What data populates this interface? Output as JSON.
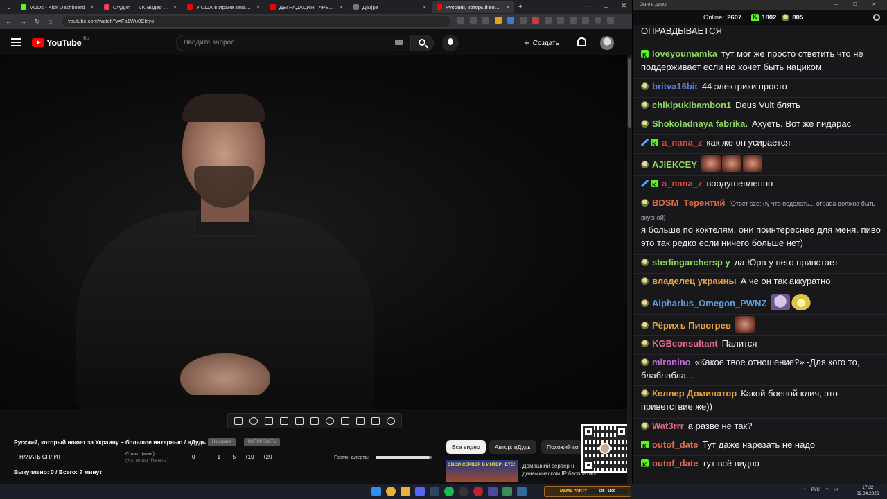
{
  "browser": {
    "tabs": [
      {
        "title": "VODs - Kick Dashboard",
        "color": "#53fc18",
        "active": false
      },
      {
        "title": "Студия — VK Видео Live",
        "color": "#ff3b5c",
        "active": false
      },
      {
        "title": "У США в Иране заканчиваются",
        "color": "#ff0000",
        "active": false
      },
      {
        "title": "ДЕГРАДАЦИЯ ТАРЕЛОЧНИЦ",
        "color": "#ff0000",
        "active": false
      },
      {
        "title": "Д[ы]ра",
        "color": "#777777",
        "active": false
      },
      {
        "title": "Русский, который воюет з",
        "color": "#ff0000",
        "active": true
      }
    ],
    "url": "youtube.com/watch?v=Fa1Wu0Cktyo"
  },
  "youtube": {
    "logo_text": "YouTube",
    "region": "RU",
    "search_placeholder": "Введите запрос",
    "create_label": "Создать"
  },
  "overlay": {
    "video_title": "Русский, который воюет за Украину – большое интервью / вДудь",
    "pill_1": "На экране",
    "pill_2": "КОПИРОВАТЬ",
    "start_split": "НАЧАТЬ СПЛИТ",
    "split_label": "Сплит (мин):",
    "split_hint": "(уст. перед \"Начать\")",
    "split_value": "0",
    "steps": [
      "+1",
      "+5",
      "+10",
      "+20"
    ],
    "alert_volume_label": "Громк. алерта:",
    "alert_volume_level": 0.95,
    "bought": "Выкуплено: 0 / Всего: ? минут",
    "chips": [
      "Все видео",
      "Автор: вДудь",
      "Похожий ко"
    ],
    "promo_banner": "СВОЙ СЕРВЕР В ИНТЕРНЕТЕ!",
    "promo_text": "Домашний сервер н динамическом IP бесплатно!..."
  },
  "chat": {
    "window_title": "Окно в дурку",
    "online_label": "Online:",
    "online_count": "2607",
    "kick_count": "1802",
    "other_count": "805",
    "messages": [
      {
        "user": "",
        "color": "#efeff1",
        "badges": [],
        "text": "ОПРАВДЫВАЕТСЯ"
      },
      {
        "user": "loveyoumamka",
        "color": "#8dd75a",
        "badges": [
          "kick"
        ],
        "text": "тут мог же просто ответить что не поддерживает если не хочет быть нациком"
      },
      {
        "user": "britva16bit",
        "color": "#5e7fd9",
        "badges": [
          "goblin"
        ],
        "text": "44 электрики просто"
      },
      {
        "user": "chikipukibambon1",
        "color": "#8dd75a",
        "badges": [
          "goblin"
        ],
        "text": "Deus Vult блять"
      },
      {
        "user": "Shokoladnaya fabrika.",
        "color": "#8dd75a",
        "badges": [
          "goblin"
        ],
        "text": "Ахуеть. Вот же пидарас"
      },
      {
        "user": "a_nana_z",
        "color": "#e0453a",
        "badges": [
          "sword",
          "kick"
        ],
        "text": "как же он усирается"
      },
      {
        "user": "AJIEKCEY",
        "color": "#8dd75a",
        "badges": [
          "goblin"
        ],
        "text": "",
        "emotes": [
          "face",
          "face",
          "face"
        ]
      },
      {
        "user": "a_nana_z",
        "color": "#e0453a",
        "badges": [
          "sword",
          "kick"
        ],
        "text": "воодушевленно"
      },
      {
        "user": "BDSM_Терентий",
        "color": "#e06a46",
        "badges": [
          "goblin"
        ],
        "reply": "[Ответ sze: ну что поделать... отрава должна быть вкусной]",
        "text": "я больше по коктелям, они поинтереснее для меня. пиво это так редко если ничего больше нет)"
      },
      {
        "user": "sterlingarchersp y",
        "color": "#8dd75a",
        "badges": [
          "goblin"
        ],
        "text": "да Юра у него привстает"
      },
      {
        "user": "владелец украины",
        "color": "#e8a33a",
        "badges": [
          "goblin"
        ],
        "text": "А че он так аккуратно"
      },
      {
        "user": "Alpharius_Omegon_PWNZ",
        "color": "#5e9fe0",
        "badges": [
          "goblin"
        ],
        "text": "",
        "emotes": [
          "anime",
          "smile"
        ]
      },
      {
        "user": "Рёрихъ Пивогрев",
        "color": "#e8a33a",
        "badges": [
          "goblin"
        ],
        "text": "",
        "emotes": [
          "face"
        ]
      },
      {
        "user": "KGBconsultant",
        "color": "#e06a8a",
        "badges": [
          "goblin"
        ],
        "text": "Палится"
      },
      {
        "user": "mironino",
        "color": "#c06ad8",
        "badges": [
          "goblin"
        ],
        "text": "«Какое твое отношение?» -Для кого то, блаблабла..."
      },
      {
        "user": "Келлер Доминатор",
        "color": "#e8a33a",
        "badges": [
          "goblin"
        ],
        "text": "Какой боевой клич, это приветствие же))"
      },
      {
        "user": "Wat3rrr",
        "color": "#e06a8a",
        "badges": [
          "goblin"
        ],
        "text": "а разве не так?"
      },
      {
        "user": "outof_date",
        "color": "#e06a46",
        "badges": [
          "kick"
        ],
        "text": "Тут даже нарезать не надо"
      },
      {
        "user": "outof_date",
        "color": "#e06a46",
        "badges": [
          "kick"
        ],
        "text": "тут всё видно"
      }
    ]
  },
  "taskbar": {
    "widget_text": "MEME PARTY",
    "widget_progress": "525 / 1500",
    "lang": "РУС",
    "time": "17:32",
    "date": "02.04.2026"
  }
}
